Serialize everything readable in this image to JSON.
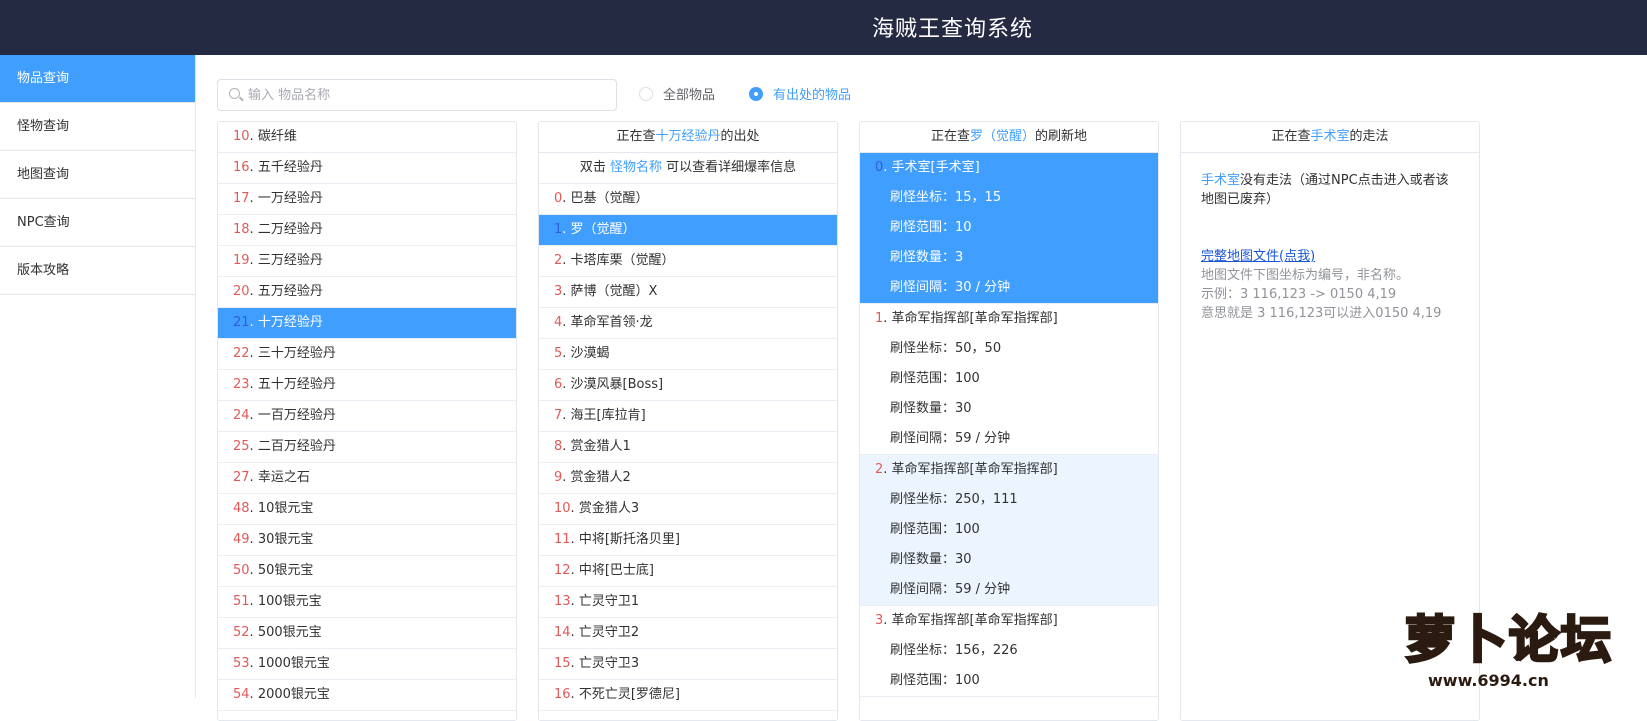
{
  "header": {
    "title": "海贼王查询系统"
  },
  "sidebar": {
    "items": [
      {
        "label": "物品查询"
      },
      {
        "label": "怪物查询"
      },
      {
        "label": "地图查询"
      },
      {
        "label": "NPC查询"
      },
      {
        "label": "版本攻略"
      }
    ]
  },
  "search": {
    "placeholder": "输入 物品名称"
  },
  "filters": {
    "all": "全部物品",
    "with_source": "有出处的物品"
  },
  "items": [
    {
      "num": "10",
      "name": "碳纤维"
    },
    {
      "num": "16",
      "name": "五千经验丹"
    },
    {
      "num": "17",
      "name": "一万经验丹"
    },
    {
      "num": "18",
      "name": "二万经验丹"
    },
    {
      "num": "19",
      "name": "三万经验丹"
    },
    {
      "num": "20",
      "name": "五万经验丹"
    },
    {
      "num": "21",
      "name": "十万经验丹"
    },
    {
      "num": "22",
      "name": "三十万经验丹"
    },
    {
      "num": "23",
      "name": "五十万经验丹"
    },
    {
      "num": "24",
      "name": "一百万经验丹"
    },
    {
      "num": "25",
      "name": "二百万经验丹"
    },
    {
      "num": "27",
      "name": "幸运之石"
    },
    {
      "num": "48",
      "name": "10银元宝"
    },
    {
      "num": "49",
      "name": "30银元宝"
    },
    {
      "num": "50",
      "name": "50银元宝"
    },
    {
      "num": "51",
      "name": "100银元宝"
    },
    {
      "num": "52",
      "name": "500银元宝"
    },
    {
      "num": "53",
      "name": "1000银元宝"
    },
    {
      "num": "54",
      "name": "2000银元宝"
    }
  ],
  "source_panel": {
    "head_pre": "正在查",
    "head_item": "十万经验丹",
    "head_post": "的出处",
    "hint_pre": "双击 ",
    "hint_link": "怪物名称",
    "hint_post": " 可以查看详细爆率信息",
    "monsters": [
      {
        "num": "0",
        "name": "巴基（觉醒）"
      },
      {
        "num": "1",
        "name": "罗（觉醒）"
      },
      {
        "num": "2",
        "name": "卡塔库栗（觉醒）"
      },
      {
        "num": "3",
        "name": "萨博（觉醒）X"
      },
      {
        "num": "4",
        "name": "革命军首领·龙"
      },
      {
        "num": "5",
        "name": "沙漠蝎"
      },
      {
        "num": "6",
        "name": "沙漠风暴[Boss]"
      },
      {
        "num": "7",
        "name": "海王[库拉肯]"
      },
      {
        "num": "8",
        "name": "赏金猎人1"
      },
      {
        "num": "9",
        "name": "赏金猎人2"
      },
      {
        "num": "10",
        "name": "赏金猎人3"
      },
      {
        "num": "11",
        "name": "中将[斯托洛贝里]"
      },
      {
        "num": "12",
        "name": "中将[巴士底]"
      },
      {
        "num": "13",
        "name": "亡灵守卫1"
      },
      {
        "num": "14",
        "name": "亡灵守卫2"
      },
      {
        "num": "15",
        "name": "亡灵守卫3"
      },
      {
        "num": "16",
        "name": "不死亡灵[罗德尼]"
      }
    ]
  },
  "spawn_panel": {
    "head_pre": "正在查",
    "head_monster": "罗（觉醒）",
    "head_post": "的刷新地",
    "spawns": [
      {
        "num": "0",
        "map": "手术室[手术室]",
        "coord": "刷怪坐标：15，15",
        "range": "刷怪范围：10",
        "count": "刷怪数量：3",
        "interval": "刷怪间隔：30 / 分钟"
      },
      {
        "num": "1",
        "map": "革命军指挥部[革命军指挥部]",
        "coord": "刷怪坐标：50，50",
        "range": "刷怪范围：100",
        "count": "刷怪数量：30",
        "interval": "刷怪间隔：59 / 分钟"
      },
      {
        "num": "2",
        "map": "革命军指挥部[革命军指挥部]",
        "coord": "刷怪坐标：250，111",
        "range": "刷怪范围：100",
        "count": "刷怪数量：30",
        "interval": "刷怪间隔：59 / 分钟"
      },
      {
        "num": "3",
        "map": "革命军指挥部[革命军指挥部]",
        "coord": "刷怪坐标：156，226",
        "range": "刷怪范围：100"
      }
    ]
  },
  "route_panel": {
    "head_pre": "正在查",
    "head_map": "手术室",
    "head_post": "的走法",
    "map_name": "手术室",
    "no_route": "没有走法（通过NPC点击进入或者该地图已废弃）",
    "link": "完整地图文件(点我)",
    "note1": "地图文件下图坐标为编号，非名称。",
    "note2": "示例：3 116,123 -> 0150 4,19",
    "note3": "意思就是 3 116,123可以进入0150 4,19"
  },
  "watermark": {
    "text": "萝卜论坛",
    "url": "www.6994.cn"
  }
}
